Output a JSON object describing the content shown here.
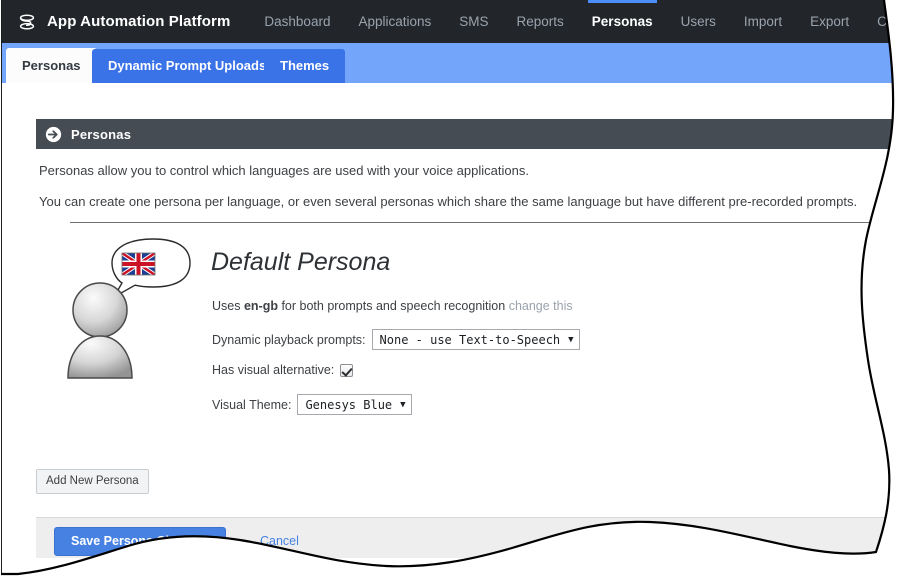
{
  "app": {
    "brand_name": "App Automation Platform",
    "logo_icon": "genesys-stack-logo-icon"
  },
  "nav": {
    "items": [
      {
        "label": "Dashboard",
        "active": false
      },
      {
        "label": "Applications",
        "active": false
      },
      {
        "label": "SMS",
        "active": false
      },
      {
        "label": "Reports",
        "active": false
      },
      {
        "label": "Personas",
        "active": true
      },
      {
        "label": "Users",
        "active": false
      },
      {
        "label": "Import",
        "active": false
      },
      {
        "label": "Export",
        "active": false
      },
      {
        "label": "CTI Viewer",
        "active": false
      }
    ]
  },
  "tabs": [
    {
      "label": "Personas",
      "selected": true
    },
    {
      "label": "Dynamic Prompt Uploads",
      "selected": false
    },
    {
      "label": "Themes",
      "selected": false
    }
  ],
  "panel": {
    "header_title": "Personas",
    "header_icon": "arrow-right-circle-icon",
    "paragraphs": [
      "Personas allow you to control which languages are used with your voice applications.",
      "You can create one persona per language, or even several personas which share the same language but have different pre-recorded prompts."
    ]
  },
  "persona": {
    "avatar_icon": "person-with-speech-bubble-icon",
    "flag_icon": "union-jack-flag-icon",
    "title": "Default Persona",
    "uses_prefix": "Uses ",
    "language_code": "en-gb",
    "uses_suffix": " for both prompts and speech recognition ",
    "change_link": "change this",
    "dynamic_prompts_label": "Dynamic playback prompts:",
    "dynamic_prompts_value": "None - use Text-to-Speech",
    "visual_alternative_label": "Has visual alternative:",
    "visual_alternative_checked": true,
    "visual_theme_label": "Visual Theme:",
    "visual_theme_value": "Genesys Blue",
    "caret_glyph": "▼"
  },
  "actions": {
    "add_new_persona": "Add New Persona",
    "save": "Save Persona Changes",
    "cancel": "Cancel"
  },
  "colors": {
    "nav_bg": "#22262b",
    "nav_active_underline": "#4c8dfc",
    "tabstrip_bg": "#73a5fb",
    "tab_bg": "#3a72e8",
    "panel_header_bg": "#454c53",
    "primary_button": "#4782e2",
    "link": "#4782e2"
  }
}
